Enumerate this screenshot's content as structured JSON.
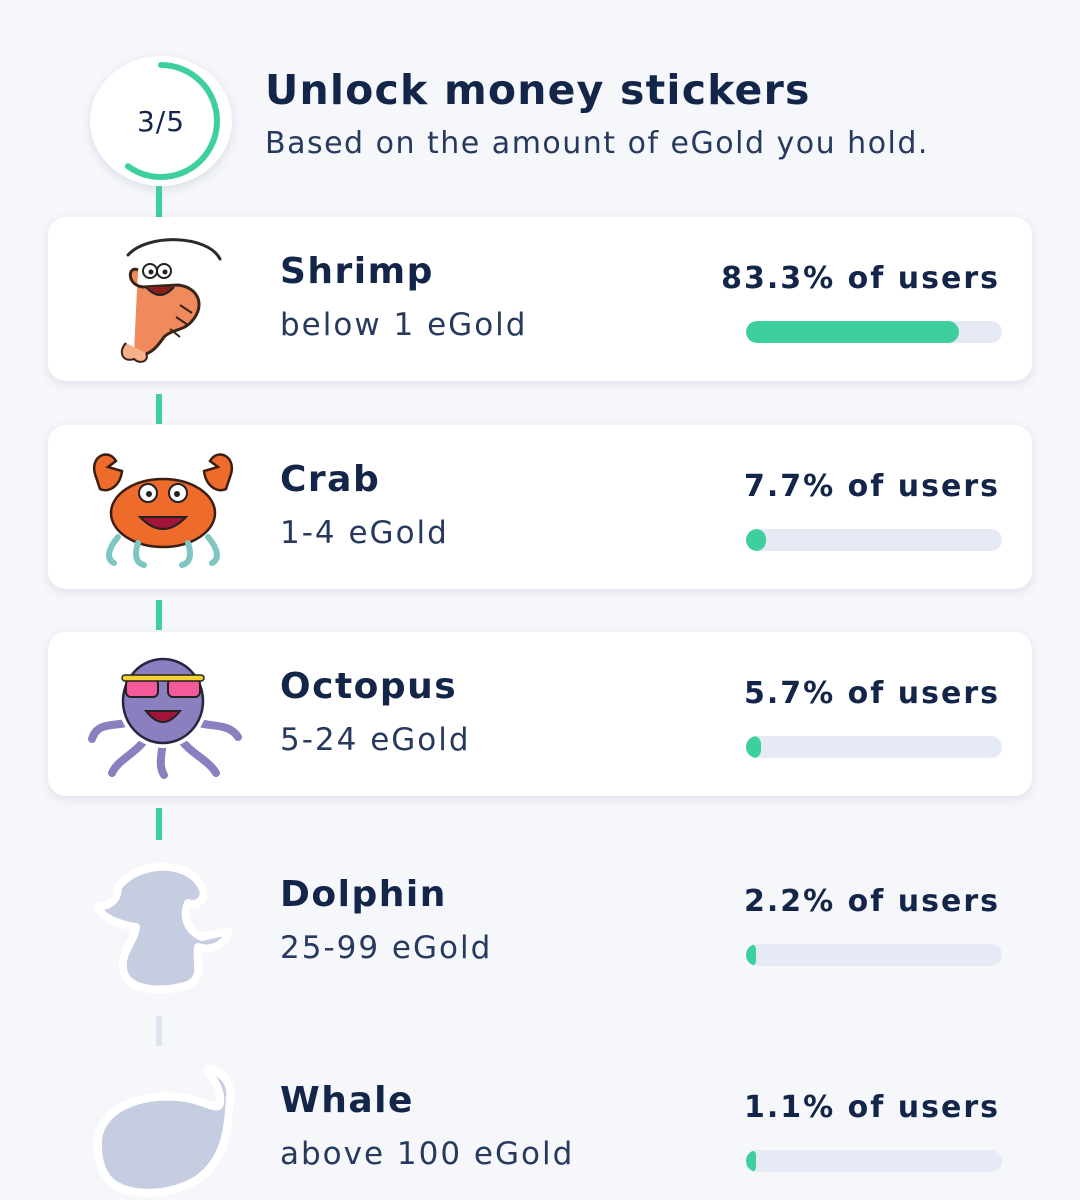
{
  "header": {
    "progress_label": "3/5",
    "progress_fraction": 0.6,
    "title": "Unlock money stickers",
    "subtitle": "Based on the amount of eGold you hold."
  },
  "colors": {
    "accent": "#3ecf9f",
    "text": "#14254a",
    "track": "#e6eaf4",
    "locked": "#c6cde0"
  },
  "tiers": [
    {
      "name": "Shrimp",
      "range": "below 1 eGold",
      "share": "83.3% of users",
      "share_value": 0.833,
      "unlocked": true,
      "icon": "shrimp-sticker-icon"
    },
    {
      "name": "Crab",
      "range": "1-4 eGold",
      "share": "7.7% of users",
      "share_value": 0.077,
      "unlocked": true,
      "icon": "crab-sticker-icon"
    },
    {
      "name": "Octopus",
      "range": "5-24 eGold",
      "share": "5.7% of users",
      "share_value": 0.057,
      "unlocked": true,
      "icon": "octopus-sticker-icon"
    },
    {
      "name": "Dolphin",
      "range": "25-99 eGold",
      "share": "2.2% of users",
      "share_value": 0.022,
      "unlocked": false,
      "icon": "dolphin-silhouette-icon"
    },
    {
      "name": "Whale",
      "range": "above 100 eGold",
      "share": "1.1% of users",
      "share_value": 0.011,
      "unlocked": false,
      "icon": "whale-silhouette-icon"
    }
  ]
}
